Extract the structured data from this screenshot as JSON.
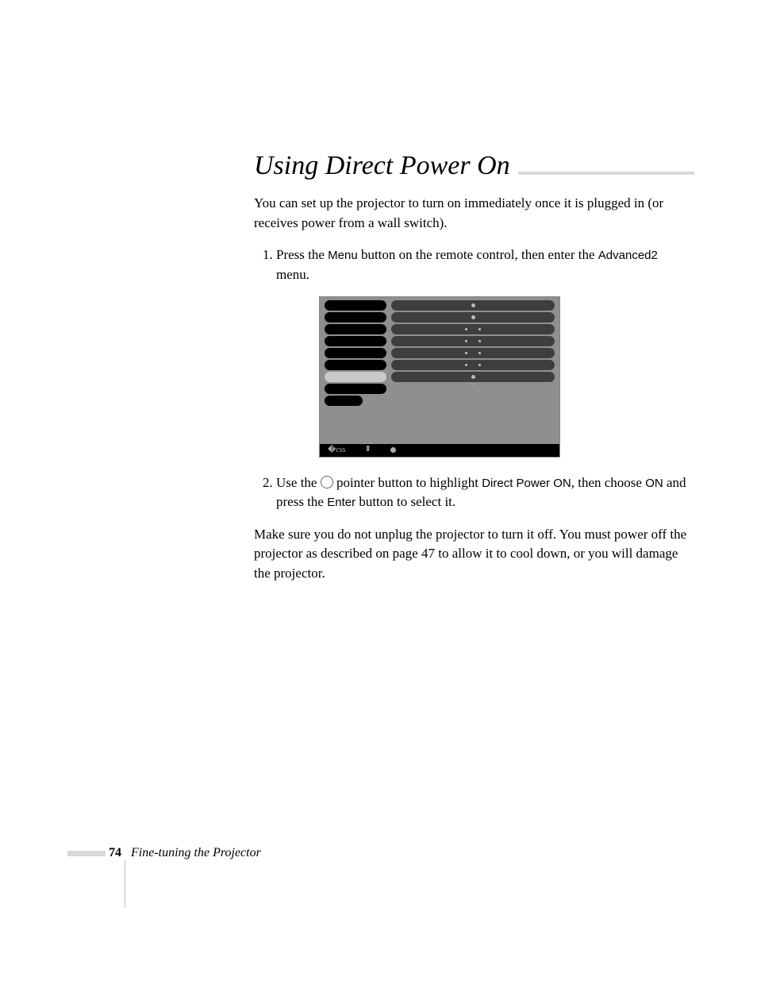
{
  "heading": "Using Direct Power On",
  "intro": "You can set up the projector to turn on immediately once it is plugged in (or receives power from a wall switch).",
  "step1": {
    "pre": "Press the ",
    "btn1": "Menu",
    "mid": " button on the remote control, then enter the ",
    "btn2": "Advanced2",
    "post": " menu."
  },
  "step2": {
    "pre": "Use the ",
    "mid1": " pointer button to highlight ",
    "opt1": "Direct Power ON",
    "mid2": ", then choose ",
    "opt2": "ON",
    "mid3": " and press the ",
    "btn": "Enter",
    "post": " button to select it."
  },
  "closing": "Make sure you do not unplug the projector to turn it off. You must power off the projector as described on page 47 to allow it to cool down, or you will damage the projector.",
  "page_number": "74",
  "footer_text": "Fine-tuning the Projector"
}
